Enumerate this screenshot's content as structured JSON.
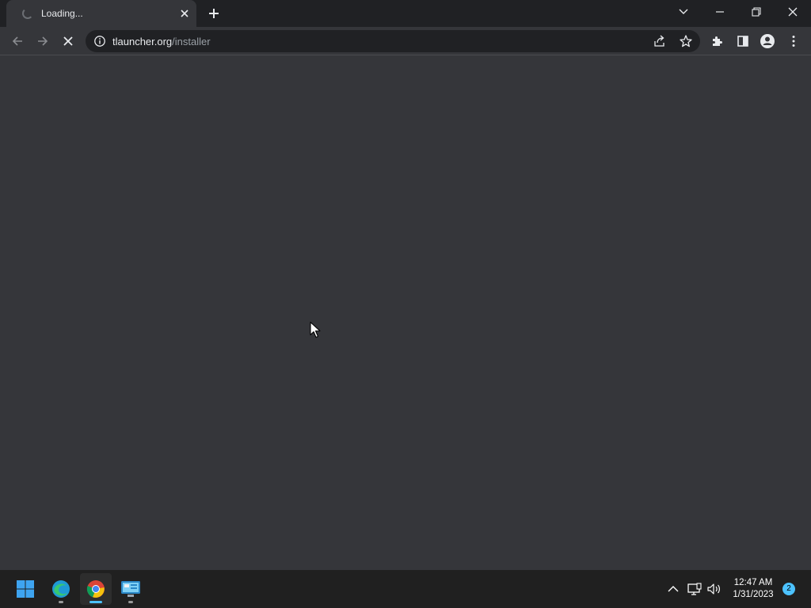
{
  "browser": {
    "tab": {
      "title": "Loading...",
      "state": "loading"
    },
    "address": {
      "domain": "tlauncher.org",
      "path": "/installer"
    },
    "accent_color": "#35363a",
    "icons": {
      "back": "arrow-left-icon",
      "forward": "arrow-right-icon",
      "stop": "x-icon",
      "site_info": "info-circle-icon",
      "share": "share-icon",
      "bookmark": "star-icon",
      "extensions": "puzzle-icon",
      "side_panel": "side-panel-icon",
      "profile": "person-icon",
      "menu": "kebab-icon"
    }
  },
  "taskbar": {
    "apps": [
      {
        "name": "Start",
        "icon": "windows-logo-icon"
      },
      {
        "name": "Microsoft Edge",
        "icon": "edge-icon"
      },
      {
        "name": "Google Chrome",
        "icon": "chrome-icon",
        "active": true
      },
      {
        "name": "Control Panel",
        "icon": "monitor-app-icon"
      }
    ],
    "clock": {
      "time": "12:47 AM",
      "date": "1/31/2023"
    },
    "notification_count": "2"
  }
}
